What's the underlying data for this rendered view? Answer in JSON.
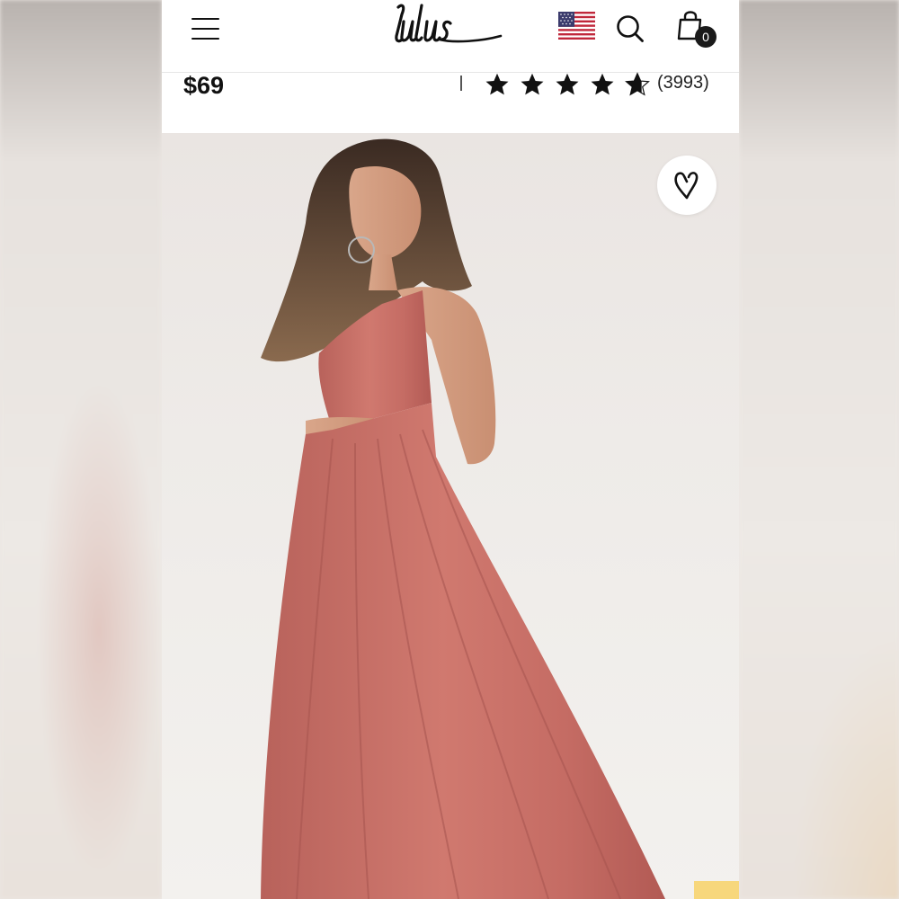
{
  "header": {
    "logo_text": "Lulus",
    "cart_count": "0",
    "icons": [
      "hamburger-menu-icon",
      "us-flag-icon",
      "search-icon",
      "shopping-bag-icon"
    ]
  },
  "product": {
    "price": "$69",
    "rating": 4.5,
    "rating_max": 5,
    "review_count": "(3993)"
  },
  "colors": {
    "dress": "#c9726a",
    "background": "#ece8e5",
    "badge": "#f7d77c"
  }
}
